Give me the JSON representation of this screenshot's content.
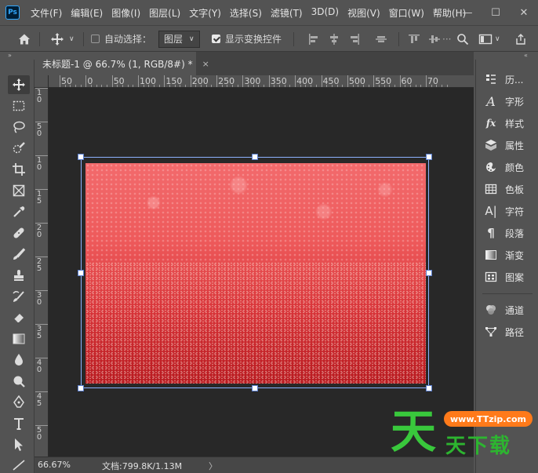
{
  "app": {
    "logo": "Ps"
  },
  "menu": [
    "文件(F)",
    "编辑(E)",
    "图像(I)",
    "图层(L)",
    "文字(Y)",
    "选择(S)",
    "滤镜(T)",
    "3D(D)",
    "视图(V)",
    "窗口(W)",
    "帮助(H)"
  ],
  "window_controls": {
    "minimize": "—",
    "maximize": "☐",
    "close": "✕"
  },
  "options": {
    "auto_select_label": "自动选择：",
    "auto_select_checked": false,
    "auto_select_target": "图层",
    "show_transform_label": "显示变换控件",
    "show_transform_checked": true
  },
  "document": {
    "tab_title": "未标题-1 @ 66.7% (1, RGB/8#) *",
    "tab_close": "×"
  },
  "ruler": {
    "h_labels": [
      "50",
      "0",
      "50",
      "100",
      "150",
      "200",
      "250",
      "300",
      "350",
      "400",
      "450",
      "500",
      "550",
      "60",
      "70"
    ],
    "v_labels": [
      "1\n0",
      "5\n0",
      "1\n0",
      "1\n5",
      "2\n0",
      "2\n5",
      "3\n0",
      "3\n5",
      "4\n0",
      "4\n5",
      "5\n0"
    ]
  },
  "status": {
    "zoom": "66.67%",
    "doc_info": "文档:799.8K/1.13M",
    "arrow": "〉"
  },
  "panels": [
    {
      "icon": "history-icon",
      "label": "历..."
    },
    {
      "icon": "character-icon",
      "label": "字形"
    },
    {
      "icon": "styles-icon",
      "label": "样式"
    },
    {
      "icon": "properties-icon",
      "label": "属性"
    },
    {
      "icon": "color-icon",
      "label": "颜色"
    },
    {
      "icon": "swatches-icon",
      "label": "色板"
    },
    {
      "icon": "type-icon",
      "label": "字符"
    },
    {
      "icon": "paragraph-icon",
      "label": "段落"
    },
    {
      "icon": "gradient-icon",
      "label": "渐变"
    },
    {
      "icon": "patterns-icon",
      "label": "图案"
    },
    {
      "icon": "channels-icon",
      "label": "通道"
    },
    {
      "icon": "paths-icon",
      "label": "路径"
    }
  ],
  "watermark": {
    "url": "www.TTzip.com",
    "big_char": "天",
    "name": "天下载"
  },
  "strip": {
    "left": "»",
    "right": "«"
  }
}
